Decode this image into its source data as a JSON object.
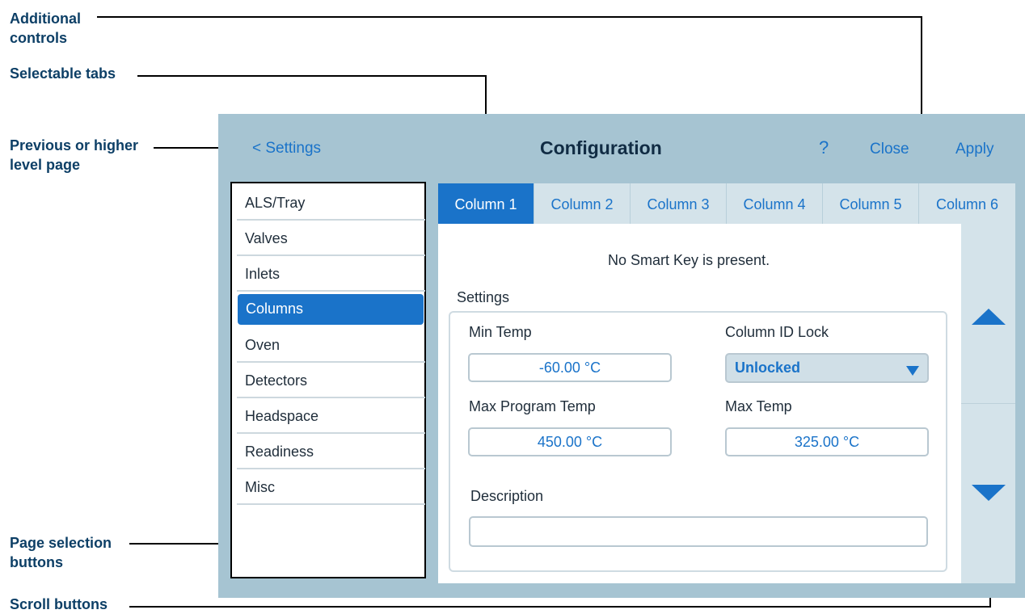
{
  "callouts": {
    "additional_controls": [
      "Additional",
      "controls"
    ],
    "selectable_tabs": "Selectable tabs",
    "previous_page": [
      "Previous or higher",
      "level page"
    ],
    "page_selection": [
      "Page selection",
      "buttons"
    ],
    "scroll_buttons": "Scroll buttons"
  },
  "header": {
    "back_label": "< Settings",
    "title": "Configuration",
    "help_label": "?",
    "close_label": "Close",
    "apply_label": "Apply"
  },
  "sidebar": {
    "items": [
      {
        "label": "ALS/Tray"
      },
      {
        "label": "Valves"
      },
      {
        "label": "Inlets"
      },
      {
        "label": "Columns",
        "selected": true
      },
      {
        "label": "Oven"
      },
      {
        "label": "Detectors"
      },
      {
        "label": "Headspace"
      },
      {
        "label": "Readiness"
      },
      {
        "label": "Misc"
      }
    ]
  },
  "tabs": [
    {
      "label": "Column 1",
      "selected": true
    },
    {
      "label": "Column 2"
    },
    {
      "label": "Column 3"
    },
    {
      "label": "Column 4"
    },
    {
      "label": "Column 5"
    },
    {
      "label": "Column 6"
    }
  ],
  "content": {
    "message": "No Smart Key is present.",
    "settings_label": "Settings",
    "min_temp": {
      "label": "Min Temp",
      "value": "-60.00 °C"
    },
    "column_id_lock": {
      "label": "Column ID Lock",
      "value": "Unlocked"
    },
    "max_program_temp": {
      "label": "Max Program Temp",
      "value": "450.00 °C"
    },
    "max_temp": {
      "label": "Max Temp",
      "value": "325.00 °C"
    },
    "description": {
      "label": "Description",
      "value": ""
    }
  },
  "scroll": {
    "up_icon": "triangle-up-icon",
    "down_icon": "triangle-down-icon"
  },
  "colors": {
    "accent": "#1a73c9",
    "panel": "#a6c4d2",
    "callout_text": "#0d3f66"
  }
}
